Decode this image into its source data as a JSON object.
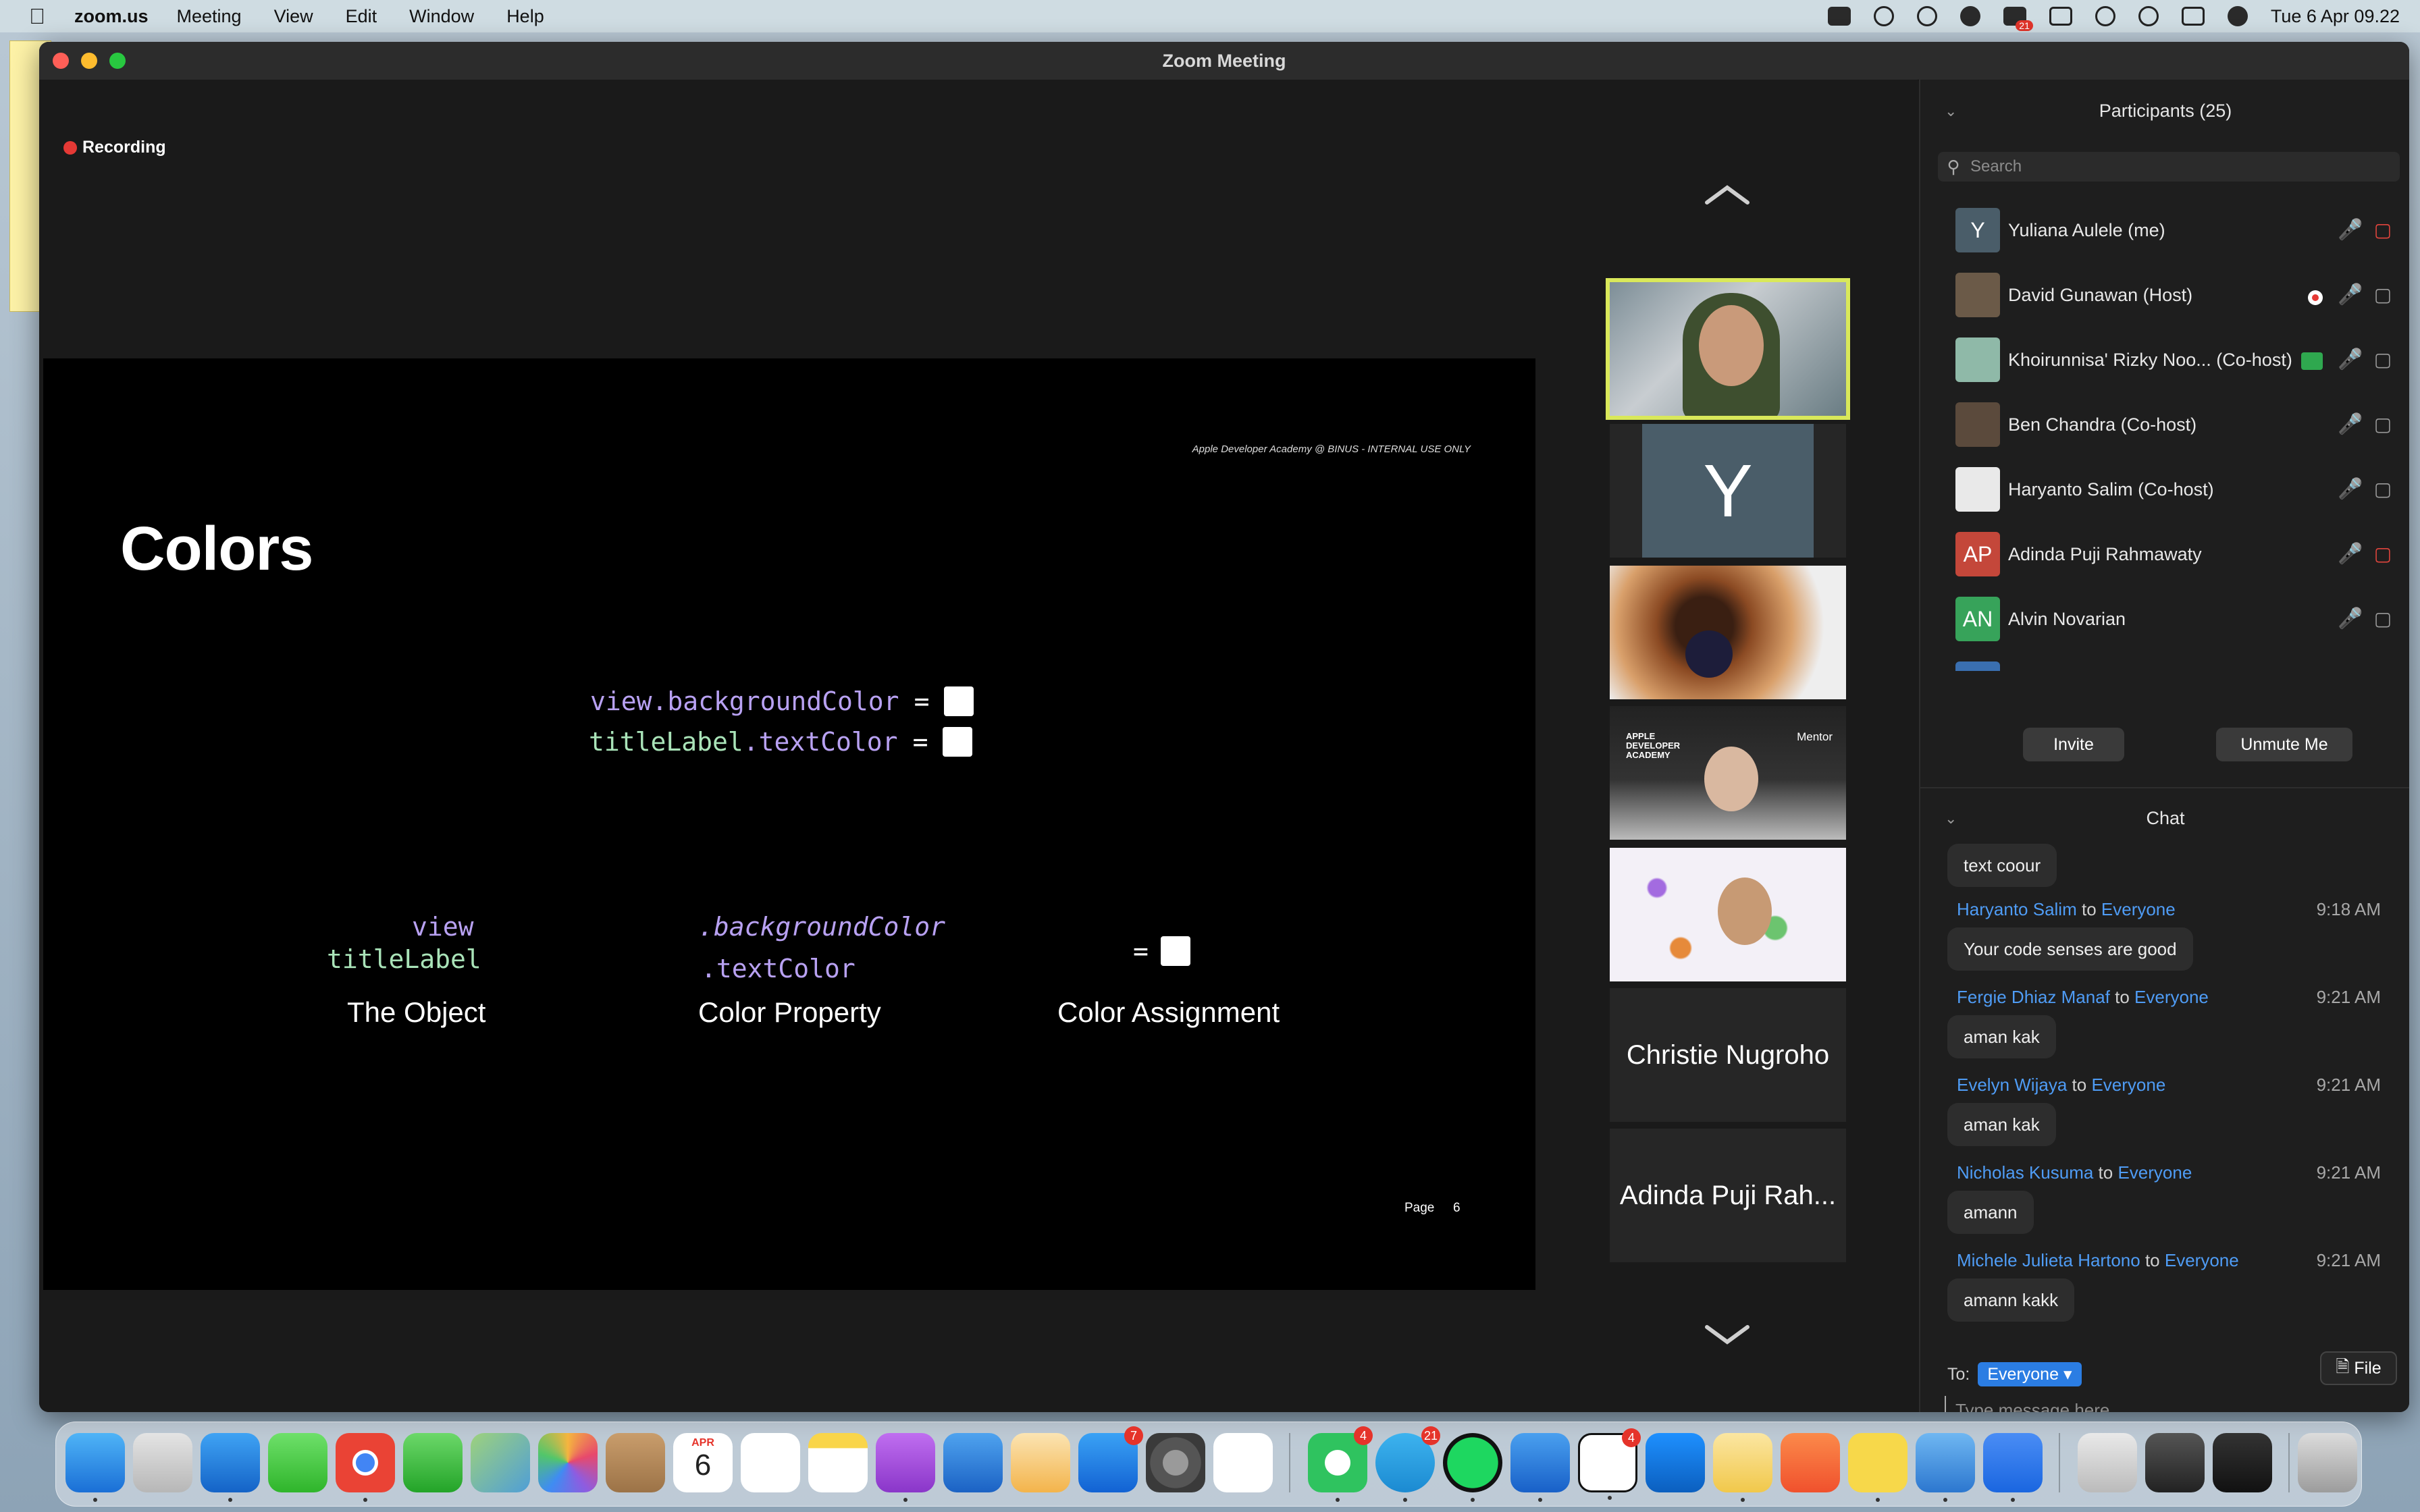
{
  "menubar": {
    "app_name": "zoom.us",
    "menus": [
      "Meeting",
      "View",
      "Edit",
      "Window",
      "Help"
    ],
    "clock": "Tue 6 Apr  09.22",
    "status_badge": "21"
  },
  "window": {
    "title": "Zoom Meeting",
    "recording_label": "Recording"
  },
  "slide": {
    "footer_note": "Apple Developer Academy @ BINUS - INTERNAL USE ONLY",
    "title": "Colors",
    "code1_obj": "view",
    "code1_prop": ".backgroundColor",
    "code2_obj": "titleLabel",
    "code2_prop": ".textColor",
    "equals": "=",
    "obj_view": "view",
    "obj_title": "titleLabel",
    "prop_bg": ".backgroundColor",
    "prop_text": ".textColor",
    "assign_equals": "=",
    "cap_object": "The Object",
    "cap_prop": "Color Property",
    "cap_assign": "Color Assignment",
    "page_label": "Page",
    "page_num": "6"
  },
  "gallery": {
    "tile2_letter": "Y",
    "tile4_academy": "APPLE DEVELOPER ACADEMY",
    "tile4_mentor": "Mentor",
    "tile6_name": "Christie Nugroho",
    "tile7_name": "Adinda Puji Rah..."
  },
  "participants": {
    "header": "Participants (25)",
    "search_placeholder": "Search",
    "list": [
      {
        "initials": "Y",
        "name": "Yuliana Aulele (me)",
        "color": "#4a5d69"
      },
      {
        "initials": "",
        "name": "David Gunawan (Host)",
        "color": "#6b5a48"
      },
      {
        "initials": "",
        "name": "Khoirunnisa' Rizky Noo...  (Co-host)",
        "color": "#8fb9a8"
      },
      {
        "initials": "",
        "name": "Ben Chandra (Co-host)",
        "color": "#5b4a3c"
      },
      {
        "initials": "",
        "name": "Haryanto Salim (Co-host)",
        "color": "#e9e9e9"
      },
      {
        "initials": "AP",
        "name": "Adinda Puji Rahmawaty",
        "color": "#c4473a"
      },
      {
        "initials": "AN",
        "name": "Alvin Novarian",
        "color": "#37a35a"
      },
      {
        "initials": "",
        "name": "",
        "color": "#3a6fb0"
      }
    ],
    "invite_label": "Invite",
    "unmute_label": "Unmute Me"
  },
  "chat": {
    "header": "Chat",
    "to_word": "to",
    "messages": [
      {
        "from": "",
        "dest": "",
        "time": "",
        "text": "text coour"
      },
      {
        "from": "Haryanto Salim",
        "dest": "Everyone",
        "time": "9:18 AM",
        "text": "Your code senses are good"
      },
      {
        "from": "Fergie Dhiaz Manaf",
        "dest": "Everyone",
        "time": "9:21 AM",
        "text": "aman kak"
      },
      {
        "from": "Evelyn Wijaya",
        "dest": "Everyone",
        "time": "9:21 AM",
        "text": "aman kak"
      },
      {
        "from": "Nicholas Kusuma",
        "dest": "Everyone",
        "time": "9:21 AM",
        "text": "amann"
      },
      {
        "from": "Michele Julieta Hartono",
        "dest": "Everyone",
        "time": "9:21 AM",
        "text": "amann kakk"
      }
    ],
    "to_label": "To:",
    "to_value": "Everyone",
    "file_label": "File",
    "more_label": "···",
    "input_placeholder": "Type message here..."
  },
  "dock": {
    "calendar_month": "APR",
    "calendar_day": "6",
    "badge_appstore": "7",
    "badge_whatsapp": "4",
    "badge_telegram": "21",
    "badge_notion": "4"
  },
  "colors": {
    "accent_blue": "#2b7de3",
    "recording_red": "#e53935",
    "active_speaker": "#d9e85a",
    "code_purple": "#b8a1f2",
    "code_green": "#a9e3b8"
  }
}
